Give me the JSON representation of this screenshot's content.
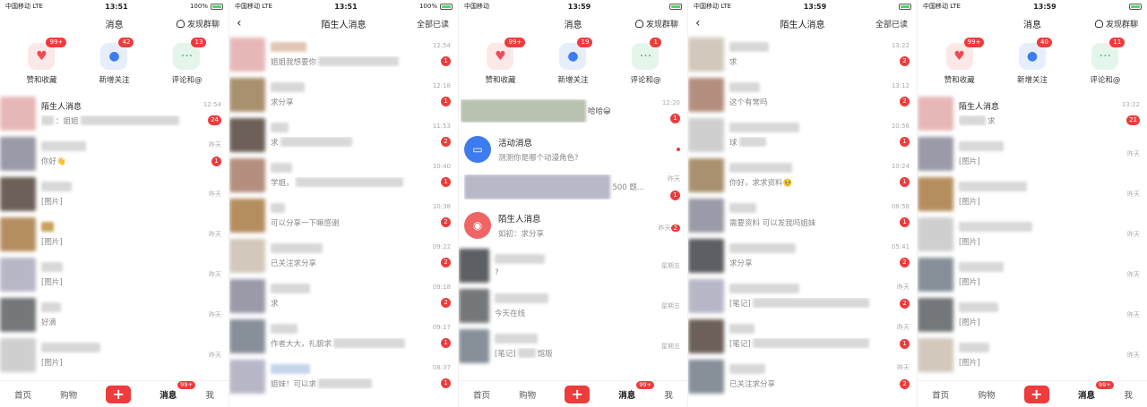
{
  "panels": [
    {
      "status": {
        "carrier": "中国移动",
        "net": "LTE",
        "time": "13:51",
        "battery": "100%"
      },
      "nav": {
        "title": "消息",
        "right": "发现群聊"
      },
      "shortcuts": [
        {
          "label": "赞和收藏",
          "badge": "99+",
          "icon": "heart-icon",
          "color": "red"
        },
        {
          "label": "新增关注",
          "badge": "42",
          "icon": "person-icon",
          "color": "blue"
        },
        {
          "label": "评论和@",
          "badge": "13",
          "icon": "chat-icon",
          "color": "green"
        }
      ],
      "items": [
        {
          "name": "陌生人消息",
          "preview": "：姐姐",
          "time": "12:54",
          "count": "24"
        },
        {
          "name": "",
          "preview": "你好👋",
          "time": "昨天",
          "count": "1"
        },
        {
          "name": "",
          "preview": "[图片]",
          "time": "昨天",
          "count": ""
        },
        {
          "name": "",
          "preview": "[图片]",
          "time": "昨天",
          "count": ""
        },
        {
          "name": "",
          "preview": "[图片]",
          "time": "昨天",
          "count": ""
        },
        {
          "name": "",
          "preview": "好滴",
          "time": "昨天",
          "count": ""
        },
        {
          "name": "",
          "preview": "[图片]",
          "time": "昨天",
          "count": ""
        }
      ],
      "tabbar": {
        "home": "首页",
        "shop": "购物",
        "plus": "+",
        "msg": "消息",
        "msg_badge": "99+",
        "me": "我"
      }
    },
    {
      "status": {
        "carrier": "中国移动",
        "net": "LTE",
        "time": "13:51",
        "battery": "100%"
      },
      "nav": {
        "back": "‹",
        "title": "陌生人消息",
        "right": "全部已读"
      },
      "items": [
        {
          "preview": "姐姐我想要你",
          "time": "12:54",
          "count": "1"
        },
        {
          "preview": "求分享",
          "time": "12:18",
          "count": "1"
        },
        {
          "preview": "求",
          "time": "11:53",
          "count": "2"
        },
        {
          "preview": "学姐，",
          "time": "10:40",
          "count": "1"
        },
        {
          "preview": "可以分享一下嘛感谢",
          "time": "10:38",
          "count": "2"
        },
        {
          "preview": "已关注求分享",
          "time": "09:22",
          "count": "2"
        },
        {
          "preview": "求",
          "time": "09:18",
          "count": "2"
        },
        {
          "preview": "作者大大，礼貌求",
          "time": "09:17",
          "count": "1"
        },
        {
          "preview": "姐妹！可以求",
          "time": "08:37",
          "count": "1"
        }
      ]
    },
    {
      "status": {
        "carrier": "中国移动",
        "time": "13:59"
      },
      "nav": {
        "title": "消息",
        "right": "发现群聊"
      },
      "shortcuts": [
        {
          "label": "赞和收藏",
          "badge": "99+",
          "icon": "heart-icon",
          "color": "red"
        },
        {
          "label": "新增关注",
          "badge": "19",
          "icon": "person-icon",
          "color": "blue"
        },
        {
          "label": "评论和@",
          "badge": "1",
          "icon": "chat-icon",
          "color": "green"
        }
      ],
      "first": {
        "preview": "哈哈😀",
        "time": "12:20",
        "count": "1"
      },
      "activity": {
        "title": "活动消息",
        "sub": "测测你是哪个动漫角色?"
      },
      "blurred": {
        "preview": "500 题...",
        "time": "昨天",
        "count": "1"
      },
      "stranger": {
        "title": "陌生人消息",
        "sub": "如初：求分享",
        "time": "昨天",
        "count": "2"
      },
      "items": [
        {
          "preview": "?",
          "time": "星期五"
        },
        {
          "preview": "今天在线",
          "time": "星期五"
        },
        {
          "preview": "[笔记]",
          "suffix": "馆版",
          "time": "星期五"
        }
      ],
      "tabbar": {
        "home": "首页",
        "shop": "购物",
        "plus": "+",
        "msg": "消息",
        "msg_badge": "99+",
        "me": "我"
      }
    },
    {
      "status": {
        "carrier": "中国移动",
        "net": "LTE",
        "time": "13:59"
      },
      "nav": {
        "back": "‹",
        "title": "陌生人消息",
        "right": "全部已读"
      },
      "items": [
        {
          "preview": "求",
          "time": "13:22",
          "count": "2"
        },
        {
          "preview": "这个有常吗",
          "time": "13:12",
          "count": "2"
        },
        {
          "preview": "球",
          "time": "10:56",
          "count": "1"
        },
        {
          "preview": "你好，求求资料🥺",
          "time": "10:24",
          "count": "1"
        },
        {
          "preview": "需要资料 可以发我吗姐妹",
          "time": "08:58",
          "count": "1"
        },
        {
          "preview": "求分享",
          "time": "05:41",
          "count": "2"
        },
        {
          "preview": "[笔记]",
          "time": "昨天",
          "count": "2"
        },
        {
          "preview": "[笔记]",
          "time": "昨天",
          "count": "1"
        },
        {
          "preview": "已关注求分享",
          "time": "昨天",
          "count": "2"
        }
      ]
    },
    {
      "status": {
        "carrier": "中国移动",
        "net": "LTE",
        "time": "13:59"
      },
      "nav": {
        "title": "消息",
        "right": "发现群聊"
      },
      "shortcuts": [
        {
          "label": "赞和收藏",
          "badge": "99+",
          "icon": "heart-icon",
          "color": "red"
        },
        {
          "label": "新增关注",
          "badge": "40",
          "icon": "person-icon",
          "color": "blue"
        },
        {
          "label": "评论和@",
          "badge": "11",
          "icon": "chat-icon",
          "color": "green"
        }
      ],
      "items": [
        {
          "name": "陌生人消息",
          "preview": "求",
          "time": "13:22",
          "count": "21"
        },
        {
          "name": "",
          "preview": "[图片]",
          "time": "昨天",
          "count": ""
        },
        {
          "name": "",
          "preview": "[图片]",
          "time": "昨天",
          "count": ""
        },
        {
          "name": "",
          "preview": "[图片]",
          "time": "昨天",
          "count": ""
        },
        {
          "name": "",
          "preview": "[图片]",
          "time": "昨天",
          "count": ""
        },
        {
          "name": "",
          "preview": "[图片]",
          "time": "昨天",
          "count": ""
        },
        {
          "name": "",
          "preview": "[图片]",
          "time": "昨天",
          "count": ""
        }
      ],
      "tabbar": {
        "home": "首页",
        "shop": "购物",
        "plus": "+",
        "msg": "消息",
        "msg_badge": "99+",
        "me": "我"
      }
    }
  ]
}
